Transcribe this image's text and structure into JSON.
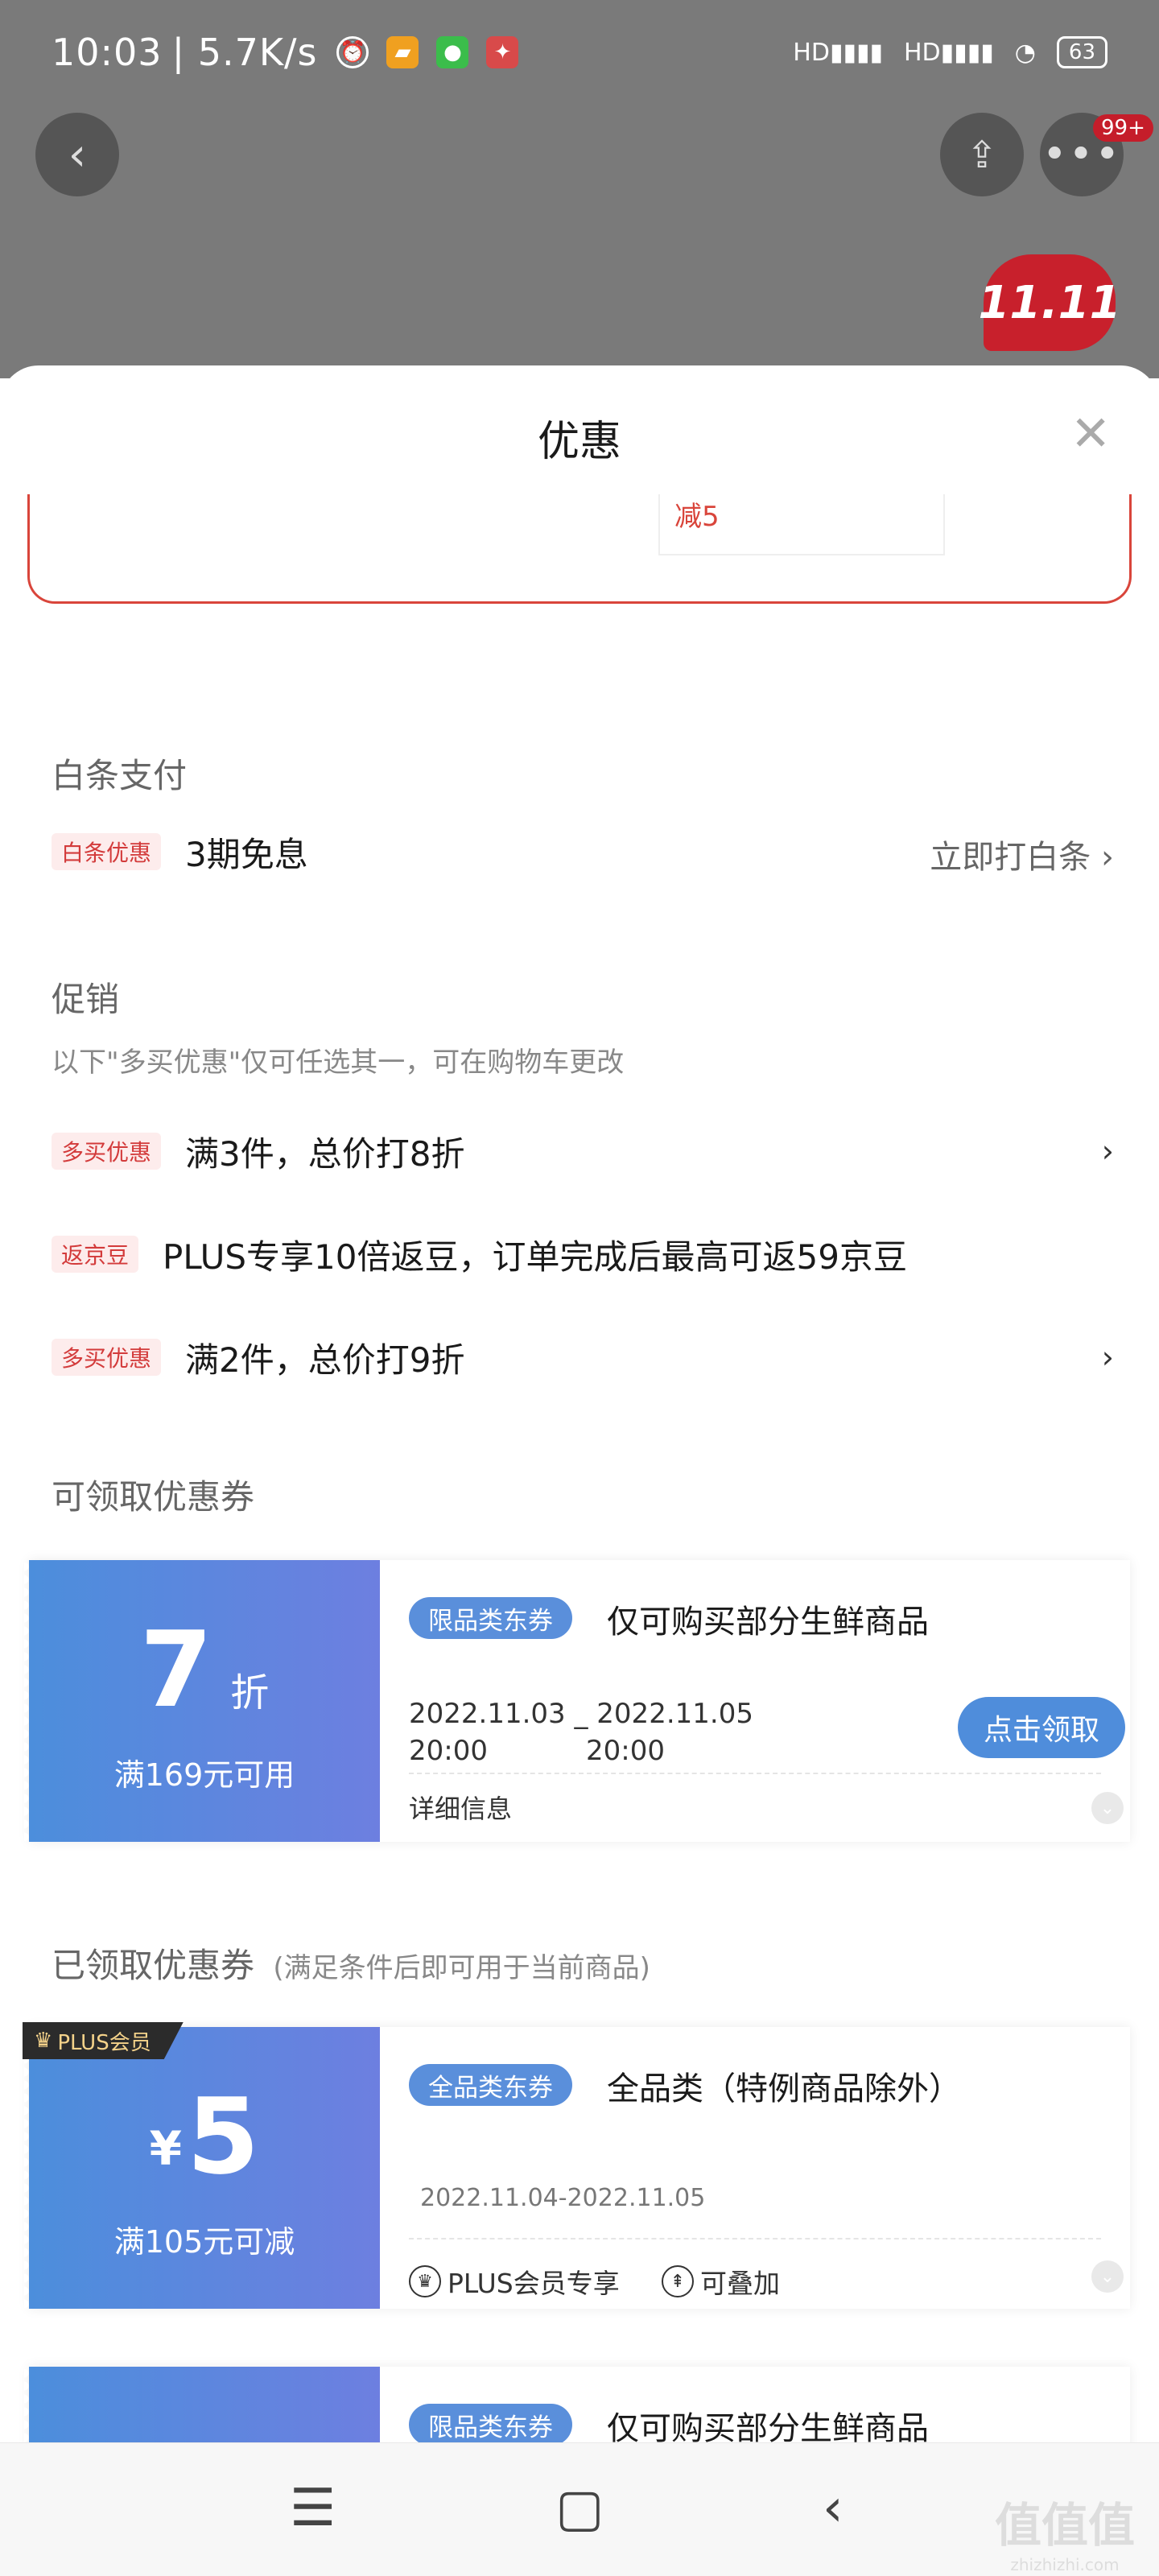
{
  "status": {
    "time": "10:03",
    "speed": "| 5.7K/s",
    "network": "HD",
    "battery": "63"
  },
  "topbar": {
    "more_badge": "99+",
    "brand_logo": "11.11"
  },
  "sheet": {
    "title": "优惠",
    "prev_text": "减5"
  },
  "baitiao": {
    "section": "白条支付",
    "tag": "白条优惠",
    "text": "3期免息",
    "link": "立即打白条"
  },
  "promo": {
    "section": "促销",
    "note": "以下\"多买优惠\"仅可任选其一，可在购物车更改",
    "items": [
      {
        "tag": "多买优惠",
        "text": "满3件，总价打8折"
      },
      {
        "tag": "返京豆",
        "text": "PLUS专享10倍返豆，订单完成后最高可返59京豆"
      },
      {
        "tag": "多买优惠",
        "text": "满2件，总价打9折"
      }
    ]
  },
  "available": {
    "section": "可领取优惠券",
    "coupon": {
      "amount": "7",
      "unit": "折",
      "condition": "满169元可用",
      "tag": "限品类东券",
      "title": "仅可购买部分生鲜商品",
      "date_start": "2022.11.03",
      "date_sep": "_",
      "date_end": "2022.11.05",
      "time_start": "20:00",
      "time_end": "20:00",
      "detail": "详细信息",
      "claim": "点击领取"
    }
  },
  "claimed": {
    "section": "已领取优惠券",
    "section_note": "(满足条件后即可用于当前商品)",
    "coupon": {
      "badge": "PLUS会员",
      "currency": "¥",
      "amount": "5",
      "condition": "满105元可减",
      "tag": "全品类东券",
      "title": "全品类（特例商品除外）",
      "date": "2022.11.04-2022.11.05",
      "meta1": "PLUS会员专享",
      "meta2": "可叠加"
    },
    "coupon2": {
      "tag": "限品类东券",
      "title": "仅可购买部分生鲜商品"
    }
  },
  "watermark": {
    "big": "值值值",
    "small": "zhizhizhi.com"
  },
  "colors": {
    "accent_red": "#d33b3b",
    "coupon_blue": "#4c8edc",
    "coupon_purple": "#6d7fe0"
  }
}
